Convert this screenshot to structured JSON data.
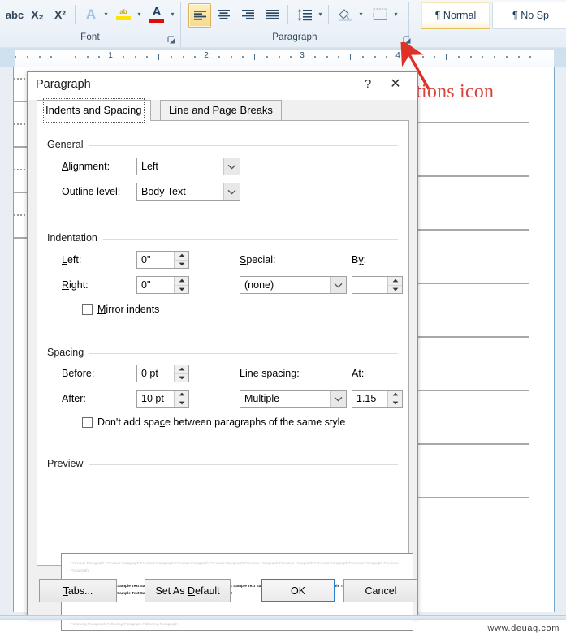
{
  "ribbon": {
    "font_group": {
      "label": "Font",
      "icons": [
        {
          "name": "strikethrough-icon",
          "glyph": "abc"
        },
        {
          "name": "subscript-icon",
          "glyph": "X₂"
        },
        {
          "name": "superscript-icon",
          "glyph": "X²"
        },
        {
          "name": "text-effects-icon",
          "glyph": "A"
        },
        {
          "name": "text-highlight-color-icon",
          "glyph": "ab"
        },
        {
          "name": "font-color-icon",
          "glyph": "A"
        }
      ],
      "launcher_name": "font-dialog-launcher"
    },
    "paragraph_group": {
      "label": "Paragraph",
      "icons": [
        {
          "name": "align-left-icon",
          "active": true
        },
        {
          "name": "align-center-icon",
          "active": false
        },
        {
          "name": "align-right-icon",
          "active": false
        },
        {
          "name": "justify-icon",
          "active": false
        },
        {
          "name": "line-and-paragraph-spacing-icon",
          "active": false
        },
        {
          "name": "shading-icon",
          "active": false
        },
        {
          "name": "borders-icon",
          "active": false
        }
      ],
      "launcher_name": "paragraph-dialog-launcher"
    },
    "styles": [
      {
        "label": "¶ Normal",
        "selected": true
      },
      {
        "label": "¶ No Sp",
        "selected": false
      }
    ]
  },
  "ruler": {
    "numbers": [
      "1",
      "2",
      "3",
      "4"
    ]
  },
  "annotation": {
    "text": "expanded options icon",
    "color": "#d8453c"
  },
  "dialog": {
    "title": "Paragraph",
    "help_button": "?",
    "close_button": "✕",
    "tabs": [
      {
        "label": "Indents and Spacing",
        "active": true
      },
      {
        "label": "Line and Page Breaks",
        "active": false
      }
    ],
    "general": {
      "title": "General",
      "alignment_label": "Alignment:",
      "alignment_value": "Left",
      "outline_label": "Outline level:",
      "outline_value": "Body Text"
    },
    "indentation": {
      "title": "Indentation",
      "left_label": "Left:",
      "left_value": "0\"",
      "right_label": "Right:",
      "right_value": "0\"",
      "special_label": "Special:",
      "special_value": "(none)",
      "by_label": "By:",
      "by_value": "",
      "mirror_label": "Mirror indents",
      "mirror_checked": false
    },
    "spacing": {
      "title": "Spacing",
      "before_label": "Before:",
      "before_value": "0 pt",
      "after_label": "After:",
      "after_value": "10 pt",
      "line_spacing_label": "Line spacing:",
      "line_spacing_value": "Multiple",
      "at_label": "At:",
      "at_value": "1.15",
      "dontadd_label": "Don't add space between paragraphs of the same style",
      "dontadd_checked": false
    },
    "preview": {
      "title": "Preview",
      "previous": "Previous Paragraph Previous Paragraph Previous Paragraph Previous Paragraph Previous Paragraph Previous Paragraph Previous Paragraph Previous Paragraph Previous Paragraph Previous Paragraph",
      "sample": "Sample Text Sample Text Sample Text Sample Text Sample Text Sample Text Sample Text Sample Text Sample Text Sample Text Sample Text Sample Text Sample Text Sample Text Sample Text Sample Text Sample Text Sample Text Sample Text Sample Text Sample Text",
      "following": "Following Paragraph Following Paragraph Following Paragraph Following Paragraph Following Paragraph Following Paragraph Following Paragraph Following Paragraph Following Paragraph Following Paragraph Following Paragraph Following Paragraph"
    },
    "buttons": {
      "tabs": "Tabs...",
      "set_as_default": "Set As Default",
      "ok": "OK",
      "cancel": "Cancel"
    }
  },
  "watermark": "www.deuaq.com"
}
